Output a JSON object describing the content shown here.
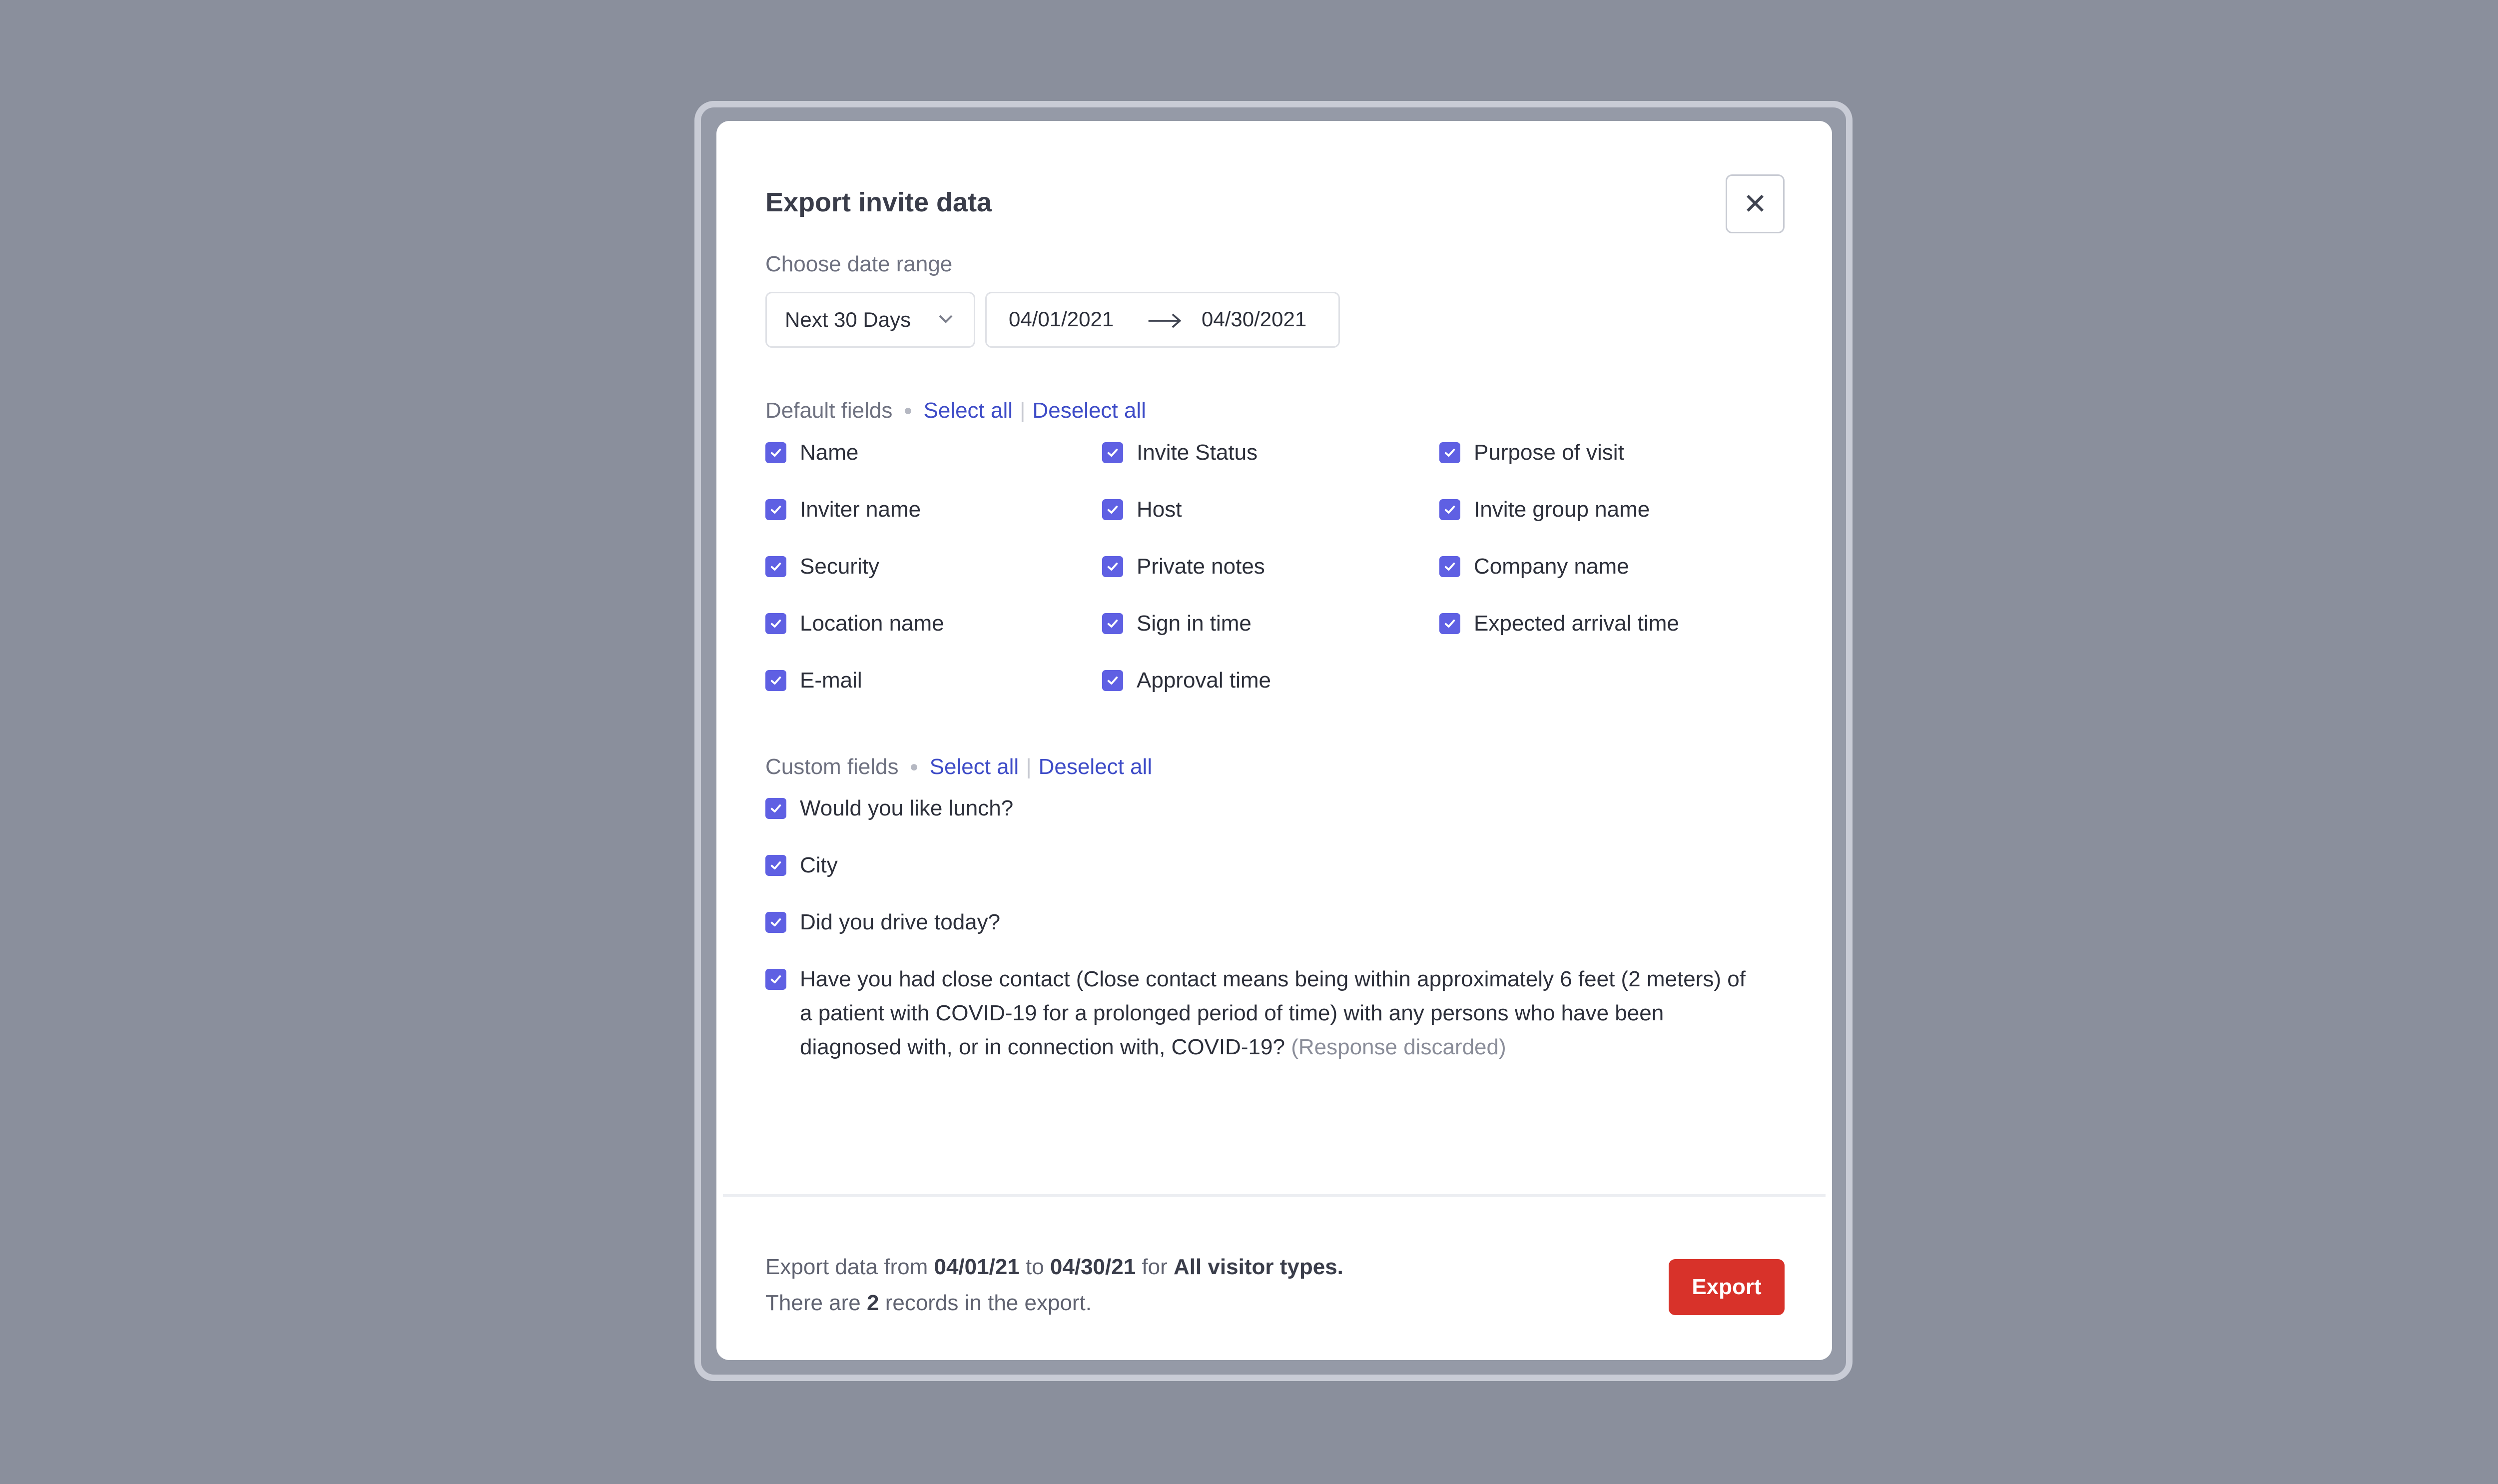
{
  "modal": {
    "title": "Export invite data",
    "close_icon": "close-icon"
  },
  "date_range": {
    "label": "Choose date range",
    "preset": "Next 30 Days",
    "start": "04/01/2021",
    "end": "04/30/2021"
  },
  "default_fields": {
    "label": "Default fields",
    "select_all": "Select all",
    "deselect_all": "Deselect all",
    "items": [
      {
        "label": "Name",
        "checked": true
      },
      {
        "label": "Invite Status",
        "checked": true
      },
      {
        "label": "Purpose of visit",
        "checked": true
      },
      {
        "label": "Inviter name",
        "checked": true
      },
      {
        "label": "Host",
        "checked": true
      },
      {
        "label": "Invite group name",
        "checked": true
      },
      {
        "label": "Security",
        "checked": true
      },
      {
        "label": "Private notes",
        "checked": true
      },
      {
        "label": "Company name",
        "checked": true
      },
      {
        "label": "Location name",
        "checked": true
      },
      {
        "label": "Sign in time",
        "checked": true
      },
      {
        "label": "Expected arrival time",
        "checked": true
      },
      {
        "label": "E-mail",
        "checked": true
      },
      {
        "label": "Approval time",
        "checked": true
      }
    ]
  },
  "custom_fields": {
    "label": "Custom fields",
    "select_all": "Select all",
    "deselect_all": "Deselect all",
    "items": [
      {
        "label": "Would you like lunch?",
        "checked": true
      },
      {
        "label": "City",
        "checked": true
      },
      {
        "label": "Did you drive today?",
        "checked": true
      },
      {
        "label": "Have you had close contact (Close contact means being within approximately 6 feet (2 meters) of a patient with COVID-19 for a prolonged period of time) with any persons who have been diagnosed with, or in connection with, COVID-19?",
        "note": "(Response discarded)",
        "checked": true
      }
    ]
  },
  "footer": {
    "line1_a": "Export data from ",
    "from": "04/01/21",
    "line1_b": " to ",
    "to": "04/30/21",
    "line1_c": " for ",
    "types": "All visitor types.",
    "line2_a": "There are ",
    "count": "2",
    "line2_b": " records in the export.",
    "export_label": "Export"
  },
  "colors": {
    "backdrop": "#8a8f9c",
    "checkbox": "#5f60e3",
    "link": "#3d4bc7",
    "export": "#d8322a"
  }
}
